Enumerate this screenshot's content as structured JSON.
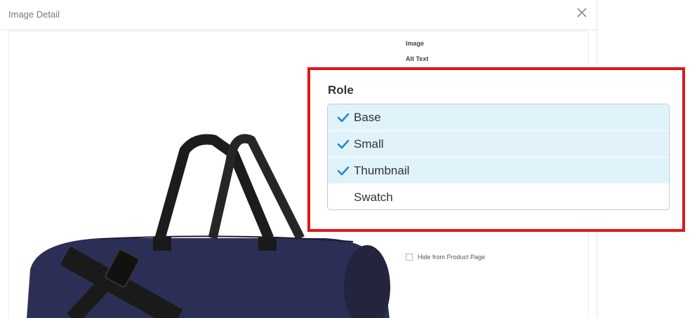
{
  "modal": {
    "title": "Image Detail",
    "close_icon": "close-icon"
  },
  "side_form": {
    "image_label": "Image",
    "alt_text_label": "Alt Text",
    "hide_label": "Hide from Product Page",
    "hide_checked": false
  },
  "role": {
    "title": "Role",
    "items": [
      {
        "label": "Base",
        "selected": true
      },
      {
        "label": "Small",
        "selected": true
      },
      {
        "label": "Thumbnail",
        "selected": true
      },
      {
        "label": "Swatch",
        "selected": false
      }
    ]
  },
  "colors": {
    "highlight_border": "#e3141b",
    "selected_bg": "#e1f3fa",
    "check_color": "#2a84c7",
    "bag_body": "#2c2f55",
    "bag_straps": "#1c1c1c"
  }
}
